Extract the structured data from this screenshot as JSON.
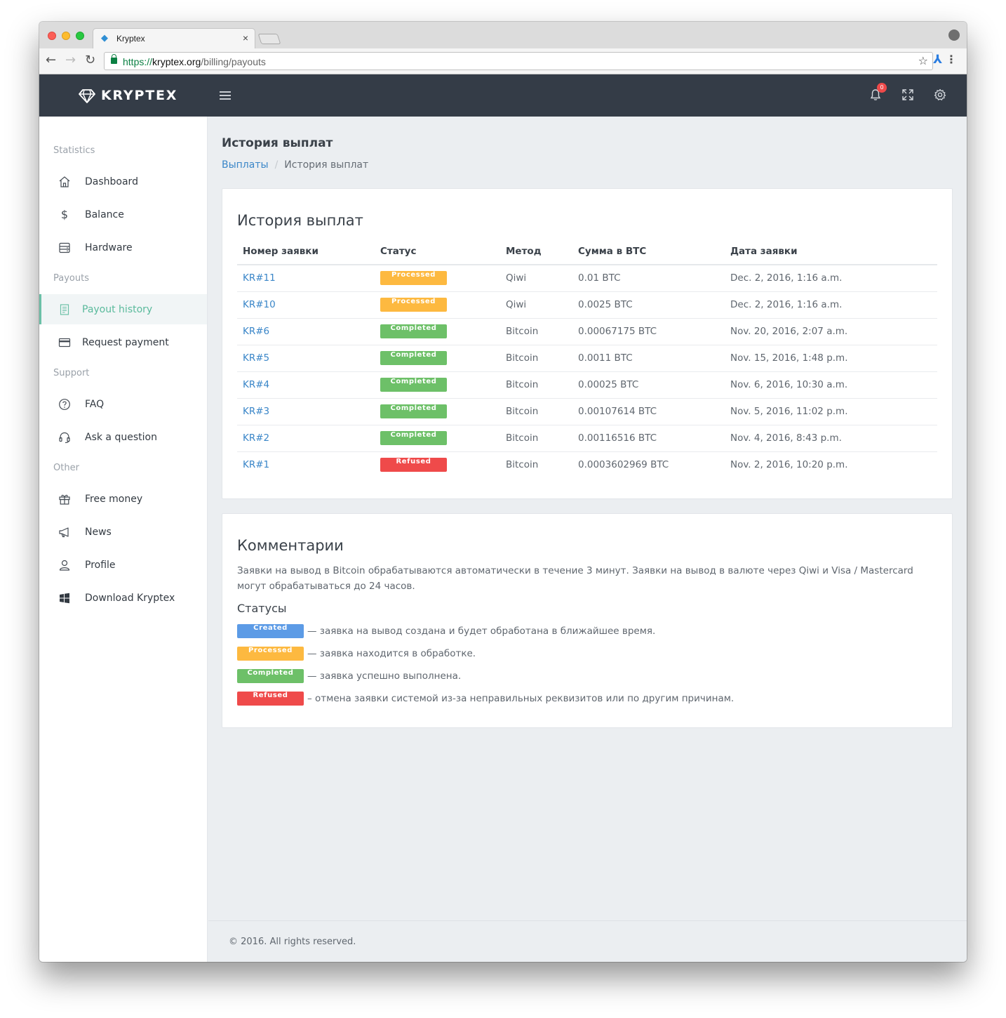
{
  "browser": {
    "tab_title": "Kryptex",
    "tab_close": "×",
    "url_scheme": "https://",
    "url_host": "kryptex.org",
    "url_path": "/billing/payouts"
  },
  "header": {
    "logo_text": "KRYPTEX",
    "notification_count": "0"
  },
  "sidebar": {
    "sections": {
      "statistics": "Statistics",
      "payouts": "Payouts",
      "support": "Support",
      "other": "Other"
    },
    "items": [
      {
        "label": "Dashboard",
        "icon": "home-icon"
      },
      {
        "label": "Balance",
        "icon": "dollar-icon"
      },
      {
        "label": "Hardware",
        "icon": "hardware-icon"
      },
      {
        "label": "Payout history",
        "icon": "receipt-icon",
        "active": true
      },
      {
        "label": "Request payment",
        "icon": "credit-card-icon"
      },
      {
        "label": "FAQ",
        "icon": "question-icon"
      },
      {
        "label": "Ask a question",
        "icon": "headset-icon"
      },
      {
        "label": "Free money",
        "icon": "gift-icon"
      },
      {
        "label": "News",
        "icon": "megaphone-icon"
      },
      {
        "label": "Profile",
        "icon": "user-icon"
      },
      {
        "label": "Download Kryptex",
        "icon": "windows-icon"
      }
    ]
  },
  "page": {
    "title": "История выплат",
    "breadcrumb": {
      "link": "Выплаты",
      "separator": "/",
      "current": "История выплат"
    }
  },
  "history": {
    "title": "История выплат",
    "columns": [
      "Номер заявки",
      "Статус",
      "Метод",
      "Сумма в BTC",
      "Дата заявки"
    ],
    "rows": [
      {
        "id": "KR#11",
        "status": "Processed",
        "status_key": "processed",
        "method": "Qiwi",
        "amount": "0.01 BTC",
        "date": "Dec. 2, 2016, 1:16 a.m."
      },
      {
        "id": "KR#10",
        "status": "Processed",
        "status_key": "processed",
        "method": "Qiwi",
        "amount": "0.0025 BTC",
        "date": "Dec. 2, 2016, 1:16 a.m."
      },
      {
        "id": "KR#6",
        "status": "Completed",
        "status_key": "completed",
        "method": "Bitcoin",
        "amount": "0.00067175 BTC",
        "date": "Nov. 20, 2016, 2:07 a.m."
      },
      {
        "id": "KR#5",
        "status": "Completed",
        "status_key": "completed",
        "method": "Bitcoin",
        "amount": "0.0011 BTC",
        "date": "Nov. 15, 2016, 1:48 p.m."
      },
      {
        "id": "KR#4",
        "status": "Completed",
        "status_key": "completed",
        "method": "Bitcoin",
        "amount": "0.00025 BTC",
        "date": "Nov. 6, 2016, 10:30 a.m."
      },
      {
        "id": "KR#3",
        "status": "Completed",
        "status_key": "completed",
        "method": "Bitcoin",
        "amount": "0.00107614 BTC",
        "date": "Nov. 5, 2016, 11:02 p.m."
      },
      {
        "id": "KR#2",
        "status": "Completed",
        "status_key": "completed",
        "method": "Bitcoin",
        "amount": "0.00116516 BTC",
        "date": "Nov. 4, 2016, 8:43 p.m."
      },
      {
        "id": "KR#1",
        "status": "Refused",
        "status_key": "refused",
        "method": "Bitcoin",
        "amount": "0.0003602969 BTC",
        "date": "Nov. 2, 2016, 10:20 p.m."
      }
    ]
  },
  "comments": {
    "title": "Комментарии",
    "text": "Заявки на вывод в Bitcoin обрабатываются автоматически в течение 3 минут. Заявки на вывод в валюте через Qiwi и Visa / Mastercard могут обрабатываться до 24 часов.",
    "statuses_title": "Статусы",
    "legend": [
      {
        "badge": "Created",
        "key": "created",
        "text": "— заявка на вывод создана и будет обработана в ближайшее время."
      },
      {
        "badge": "Processed",
        "key": "processed",
        "text": "— заявка находится в обработке."
      },
      {
        "badge": "Completed",
        "key": "completed",
        "text": "— заявка успешно выполнена."
      },
      {
        "badge": "Refused",
        "key": "refused",
        "text": "– отмена заявки системой из-за неправильных реквизитов или по другим причинам."
      }
    ]
  },
  "footer": {
    "text": "© 2016. All rights reserved."
  },
  "colors": {
    "header_bg": "#343c47",
    "accent": "#5aba9c",
    "link": "#3a86c8",
    "processed": "#fdb940",
    "completed": "#6dc068",
    "refused": "#ef4a4a",
    "created": "#5c9be6"
  }
}
